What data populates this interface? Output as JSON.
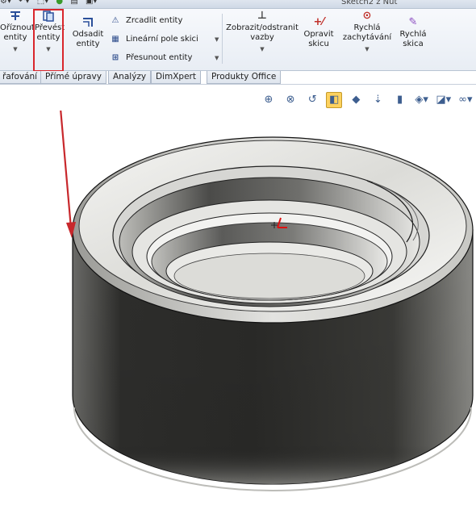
{
  "window": {
    "sketch_name": "Sketch2 z Nut"
  },
  "ribbon": {
    "trim": {
      "label_line1": "Oříznout",
      "label_line2": "entity",
      "icon": "trim-icon"
    },
    "convert": {
      "label_line1": "Převést",
      "label_line2": "entity",
      "icon": "convert-entities-icon"
    },
    "offset": {
      "label_line1": "Odsadit",
      "label_line2": "entity",
      "icon": "offset-icon"
    },
    "mirror": {
      "label": "Zrcadlit entity",
      "icon": "mirror-icon"
    },
    "linear_pattern": {
      "label": "Lineární pole skici",
      "icon": "linear-pattern-icon"
    },
    "move": {
      "label": "Přesunout entity",
      "icon": "move-icon"
    },
    "relations": {
      "label_line1": "Zobrazit/odstranit",
      "label_line2": "vazby",
      "icon": "relations-icon"
    },
    "repair": {
      "label_line1": "Opravit",
      "label_line2": "skicu",
      "icon": "repair-sketch-icon"
    },
    "quick_snaps": {
      "label_line1": "Rychlá",
      "label_line2": "zachytávání",
      "icon": "quick-snaps-icon"
    },
    "rapid_sketch": {
      "label_line1": "Rychlá",
      "label_line2": "skica",
      "icon": "rapid-sketch-icon"
    }
  },
  "tabs": [
    "řafování",
    "Přímé úpravy",
    "Analýzy",
    "DimXpert",
    "Produkty Office"
  ],
  "view_toolbar": [
    "zoom-to-fit-icon",
    "zoom-area-icon",
    "previous-view-icon",
    "section-view-icon",
    "view-orientation-icon",
    "display-style-icon",
    "hide-show-icon",
    "edit-appearance-icon",
    "apply-scene-icon",
    "view-settings-icon"
  ],
  "colors": {
    "highlight_box": "#d9262c",
    "annotation_arrow": "#c8282c"
  }
}
